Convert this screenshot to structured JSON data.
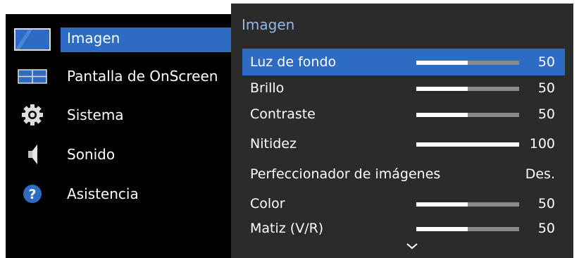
{
  "main_menu": {
    "items": [
      {
        "label": "Imagen",
        "icon": "picture-icon"
      },
      {
        "label": "Pantalla de OnScreen",
        "icon": "screen-layout-icon"
      },
      {
        "label": "Sistema",
        "icon": "gear-icon"
      },
      {
        "label": "Sonido",
        "icon": "speaker-icon"
      },
      {
        "label": "Asistencia",
        "icon": "help-icon"
      }
    ],
    "selected": "Imagen"
  },
  "sub_menu": {
    "title": "Imagen",
    "rows": [
      {
        "label": "Luz de fondo",
        "value": "50",
        "level": 0.5
      },
      {
        "label": "Brillo",
        "value": "50",
        "level": 0.5
      },
      {
        "label": "Contraste",
        "value": "50",
        "level": 0.5
      },
      {
        "label": "Nitidez",
        "value": "100",
        "level": 1.0
      },
      {
        "label": "Perfeccionador de imágenes",
        "value": "Des."
      },
      {
        "label": "Color",
        "value": "50",
        "level": 0.5
      },
      {
        "label": "Matiz (V/R)",
        "value": "50",
        "level": 0.5
      }
    ],
    "selected_row": "Luz de fondo",
    "scroll_indicator": "chevron-down-icon"
  },
  "colors": {
    "accent": "#2e6bc2",
    "panel_bg": "#2b2b2b",
    "menu_bg": "#000000",
    "title_color": "#8fb8ee"
  }
}
